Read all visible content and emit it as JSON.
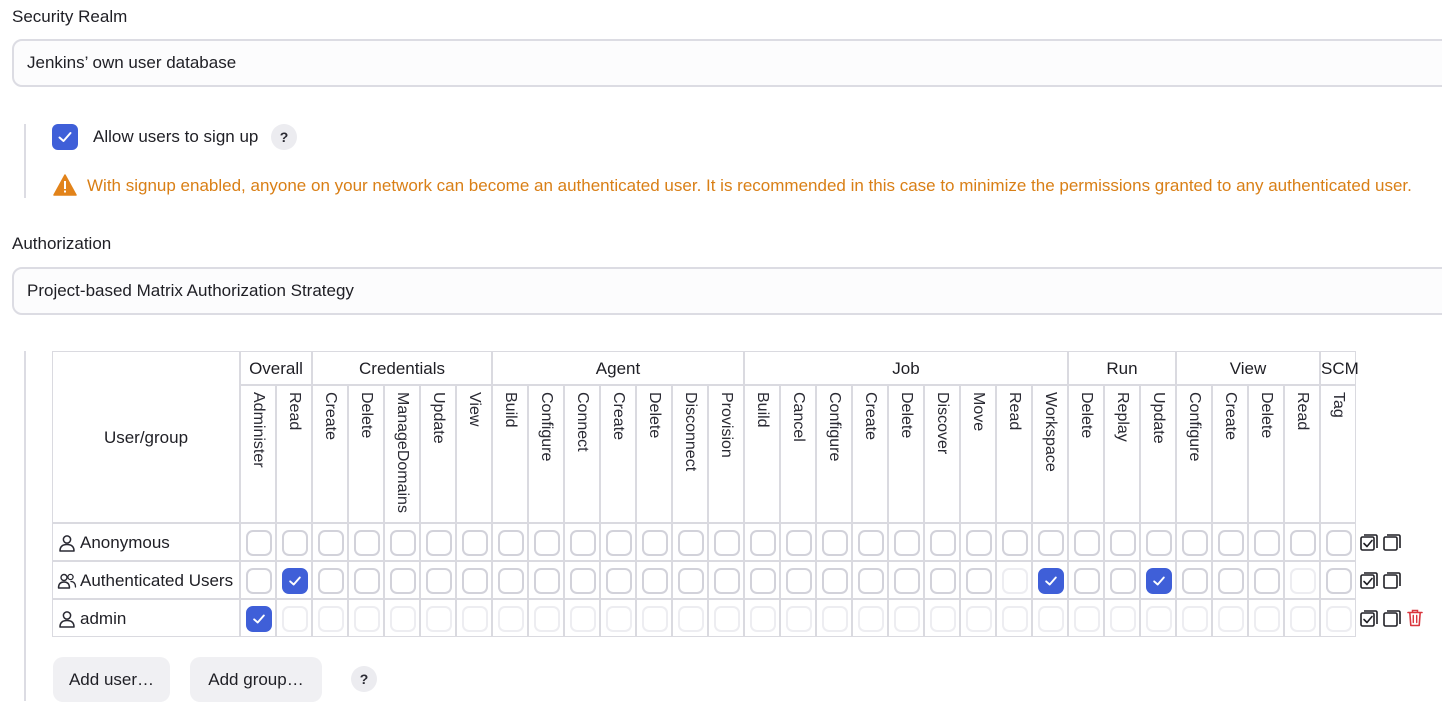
{
  "security_realm": {
    "label": "Security Realm",
    "selected": "Jenkins’ own user database",
    "allow_signup": {
      "label": "Allow users to sign up",
      "checked": true,
      "help": "?"
    },
    "warning": "With signup enabled, anyone on your network can become an authenticated user. It is recommended in this case to minimize the permissions granted to any authenticated user."
  },
  "authorization": {
    "label": "Authorization",
    "selected": "Project-based Matrix Authorization Strategy"
  },
  "matrix": {
    "user_group_header": "User/group",
    "groups": [
      {
        "name": "Overall",
        "permissions": [
          "Administer",
          "Read"
        ]
      },
      {
        "name": "Credentials",
        "permissions": [
          "Create",
          "Delete",
          "ManageDomains",
          "Update",
          "View"
        ]
      },
      {
        "name": "Agent",
        "permissions": [
          "Build",
          "Configure",
          "Connect",
          "Create",
          "Delete",
          "Disconnect",
          "Provision"
        ]
      },
      {
        "name": "Job",
        "permissions": [
          "Build",
          "Cancel",
          "Configure",
          "Create",
          "Delete",
          "Discover",
          "Move",
          "Read",
          "Workspace"
        ]
      },
      {
        "name": "Run",
        "permissions": [
          "Delete",
          "Replay",
          "Update"
        ]
      },
      {
        "name": "View",
        "permissions": [
          "Configure",
          "Create",
          "Delete",
          "Read"
        ]
      },
      {
        "name": "SCM",
        "permissions": [
          "Tag"
        ]
      }
    ],
    "rows": [
      {
        "name": "Anonymous",
        "type": "user",
        "checked": [],
        "disabled": [],
        "deletable": false
      },
      {
        "name": "Authenticated Users",
        "type": "group",
        "checked": [
          1,
          22,
          25
        ],
        "disabled": [
          21,
          29
        ],
        "deletable": false
      },
      {
        "name": "admin",
        "type": "user",
        "checked": [
          0
        ],
        "disabled": [
          1,
          2,
          3,
          4,
          5,
          6,
          7,
          8,
          9,
          10,
          11,
          12,
          13,
          14,
          15,
          16,
          17,
          18,
          19,
          20,
          21,
          22,
          23,
          24,
          25,
          26,
          27,
          28,
          29,
          30,
          31,
          32,
          33,
          34
        ],
        "deletable": true
      }
    ]
  },
  "buttons": {
    "add_user": "Add user…",
    "add_group": "Add group…",
    "help": "?"
  },
  "colors": {
    "accent": "#3f5fd8",
    "warning": "#d97f16",
    "danger": "#d9363e"
  }
}
